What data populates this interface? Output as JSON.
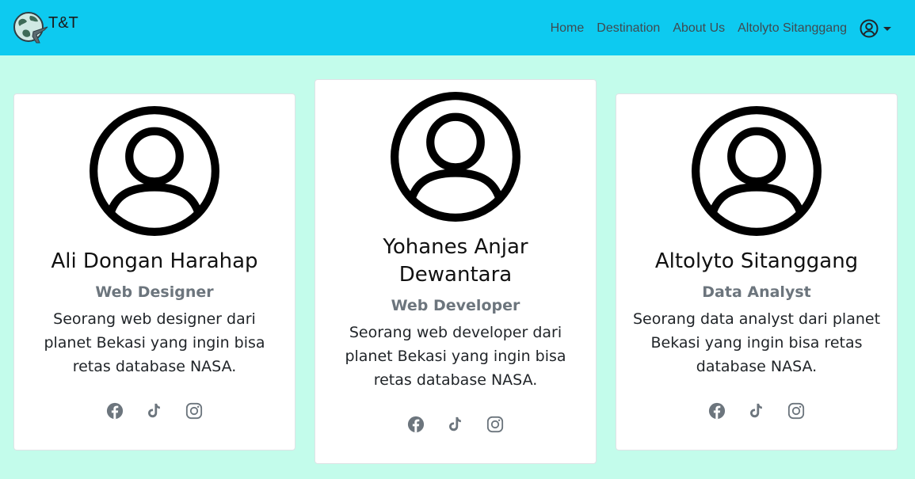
{
  "navbar": {
    "brand": "T&T",
    "links": [
      "Home",
      "Destination",
      "About Us",
      "Altolyto Sitanggang"
    ],
    "user_icon": "user-circle-icon",
    "bg_color": "#0dcaf0"
  },
  "page": {
    "bg_color": "#c3fceb"
  },
  "team": [
    {
      "name": "Ali Dongan Harahap",
      "role": "Web Designer",
      "desc": "Seorang web designer dari planet Bekasi yang ingin bisa retas database NASA."
    },
    {
      "name": "Yohanes Anjar Dewantara",
      "role": "Web Developer",
      "desc": "Seorang web developer dari planet Bekasi yang ingin bisa retas database NASA."
    },
    {
      "name": "Altolyto Sitanggang",
      "role": "Data Analyst",
      "desc": "Seorang data analyst dari planet Bekasi yang ingin bisa retas database NASA."
    }
  ],
  "social_icons": [
    "facebook-icon",
    "tiktok-icon",
    "instagram-icon"
  ]
}
